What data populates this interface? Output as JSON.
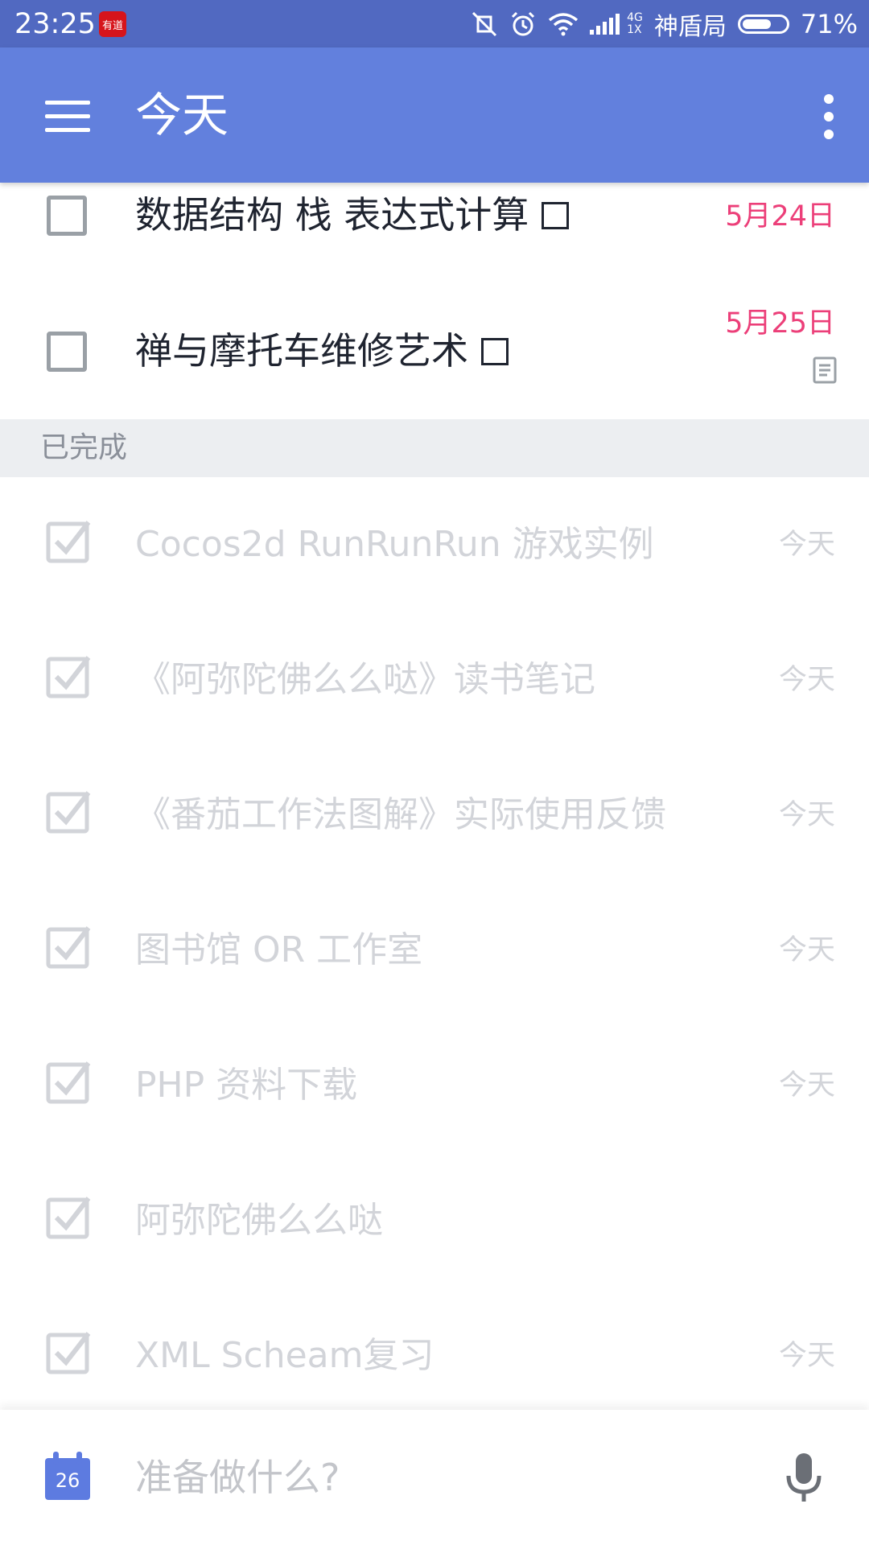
{
  "status_bar": {
    "time": "23:25",
    "app_icon_text": "有道",
    "network_type": "4G",
    "network_sub": "1X",
    "carrier": "神盾局",
    "battery_percent": "71%",
    "battery_level": 0.71
  },
  "app_bar": {
    "title": "今天",
    "menu_icon": "hamburger-menu-icon",
    "more_icon": "more-vert-icon"
  },
  "tasks": [
    {
      "title": "数据结构 栈 表达式计算",
      "date": "5月24日",
      "has_note": false
    },
    {
      "title": "禅与摩托车维修艺术",
      "date": "5月25日",
      "has_note": true
    }
  ],
  "completed_section": {
    "header": "已完成",
    "items": [
      {
        "title": "Cocos2d RunRunRun 游戏实例",
        "date": "今天"
      },
      {
        "title": "《阿弥陀佛么么哒》读书笔记",
        "date": "今天"
      },
      {
        "title": "《番茄工作法图解》实际使用反馈",
        "date": "今天"
      },
      {
        "title": "图书馆 OR 工作室",
        "date": "今天"
      },
      {
        "title": "PHP 资料下载",
        "date": "今天"
      },
      {
        "title": "阿弥陀佛么么哒",
        "date": ""
      },
      {
        "title": "XML Scheam复习",
        "date": "今天"
      }
    ]
  },
  "bottom_bar": {
    "calendar_day": "26",
    "input_placeholder": "准备做什么?",
    "input_value": ""
  },
  "colors": {
    "status_bar": "#5169c1",
    "app_bar": "#6280dd",
    "due_date": "#ec3f79",
    "completed_text": "#d2d4d9"
  }
}
